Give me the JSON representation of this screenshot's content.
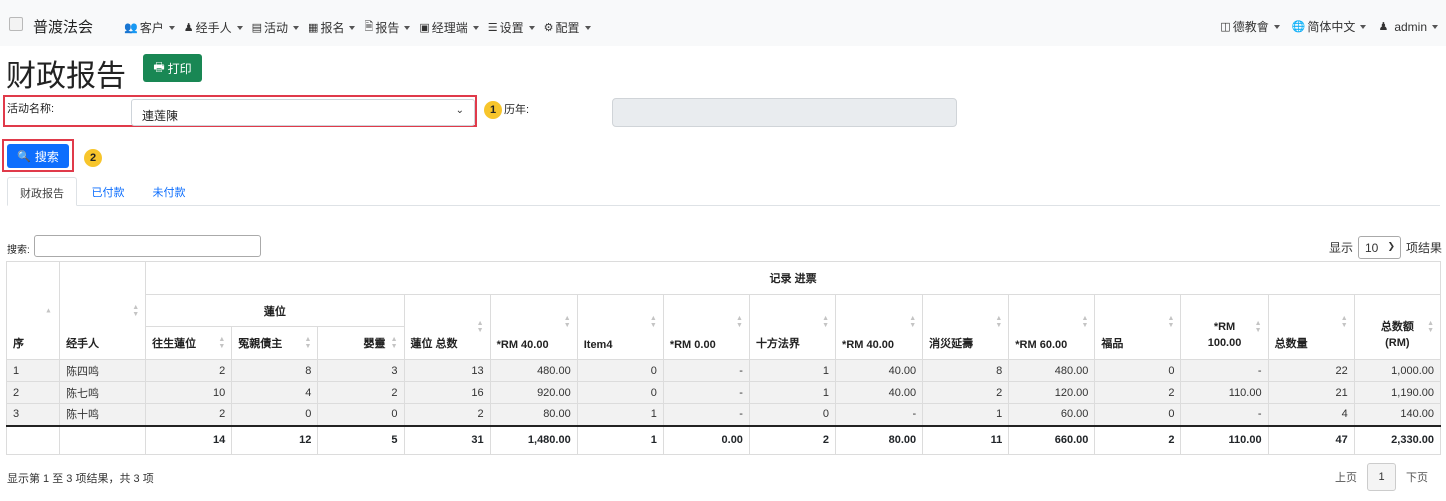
{
  "navbar": {
    "brand": "普渡法会",
    "menu": [
      {
        "icon": "users-icon",
        "label": "客户"
      },
      {
        "icon": "user-tie-icon",
        "label": "经手人"
      },
      {
        "icon": "map-icon",
        "label": "活动"
      },
      {
        "icon": "list-icon",
        "label": "报名"
      },
      {
        "icon": "file-icon",
        "label": "报告"
      },
      {
        "icon": "briefcase-icon",
        "label": "经理端"
      },
      {
        "icon": "sliders-icon",
        "label": "设置"
      },
      {
        "icon": "gear-icon",
        "label": "配置"
      }
    ],
    "right": [
      {
        "icon": "building-icon",
        "label": "德教會"
      },
      {
        "icon": "globe-icon",
        "label": "简体中文"
      },
      {
        "icon": "user-icon",
        "label": "admin"
      }
    ]
  },
  "header": {
    "title": "财政报告",
    "print_label": "打印"
  },
  "filters": {
    "event_label": "活动名称:",
    "event_value": "連莲陳",
    "year_label": "历年:",
    "year_value": "",
    "search_label": "搜索",
    "annotations": [
      "1",
      "2"
    ]
  },
  "tabs": [
    "财政报告",
    "已付款",
    "未付款"
  ],
  "table_controls": {
    "search_label": "搜索:",
    "search_value": "",
    "length_prefix": "显示",
    "length_value": "10",
    "length_suffix": "项结果"
  },
  "table": {
    "group_header": "记录 进票",
    "subgroup_header": "蓮位",
    "headers": {
      "seq": "序",
      "handler": "经手人",
      "c1": "往生蓮位",
      "c2": "冤親債主",
      "c3": "嬰靈",
      "c4": "蓮位 总数",
      "c5": "*RM 40.00",
      "c6": "Item4",
      "c7": "*RM 0.00",
      "c8": "十方法界",
      "c9": "*RM 40.00",
      "c10": "消災延壽",
      "c11": "*RM 60.00",
      "c12": "福品",
      "c13": "*RM 100.00",
      "c14": "总数量",
      "c15": "总数额 (RM)"
    },
    "rows": [
      {
        "seq": "1",
        "handler": "陈四鸣",
        "c1": "2",
        "c2": "8",
        "c3": "3",
        "c4": "13",
        "c5": "480.00",
        "c6": "0",
        "c7": "-",
        "c8": "1",
        "c9": "40.00",
        "c10": "8",
        "c11": "480.00",
        "c12": "0",
        "c13": "-",
        "c14": "22",
        "c15": "1,000.00"
      },
      {
        "seq": "2",
        "handler": "陈七鸣",
        "c1": "10",
        "c2": "4",
        "c3": "2",
        "c4": "16",
        "c5": "920.00",
        "c6": "0",
        "c7": "-",
        "c8": "1",
        "c9": "40.00",
        "c10": "2",
        "c11": "120.00",
        "c12": "2",
        "c13": "110.00",
        "c14": "21",
        "c15": "1,190.00"
      },
      {
        "seq": "3",
        "handler": "陈十鸣",
        "c1": "2",
        "c2": "0",
        "c3": "0",
        "c4": "2",
        "c5": "80.00",
        "c6": "1",
        "c7": "-",
        "c8": "0",
        "c9": "-",
        "c10": "1",
        "c11": "60.00",
        "c12": "0",
        "c13": "-",
        "c14": "4",
        "c15": "140.00"
      }
    ],
    "totals": {
      "c1": "14",
      "c2": "12",
      "c3": "5",
      "c4": "31",
      "c5": "1,480.00",
      "c6": "1",
      "c7": "0.00",
      "c8": "2",
      "c9": "80.00",
      "c10": "11",
      "c11": "660.00",
      "c12": "2",
      "c13": "110.00",
      "c14": "47",
      "c15": "2,330.00"
    }
  },
  "footer": {
    "info": "显示第 1 至 3 项结果，共 3 项",
    "prev": "上页",
    "current_page": "1",
    "next": "下页"
  }
}
